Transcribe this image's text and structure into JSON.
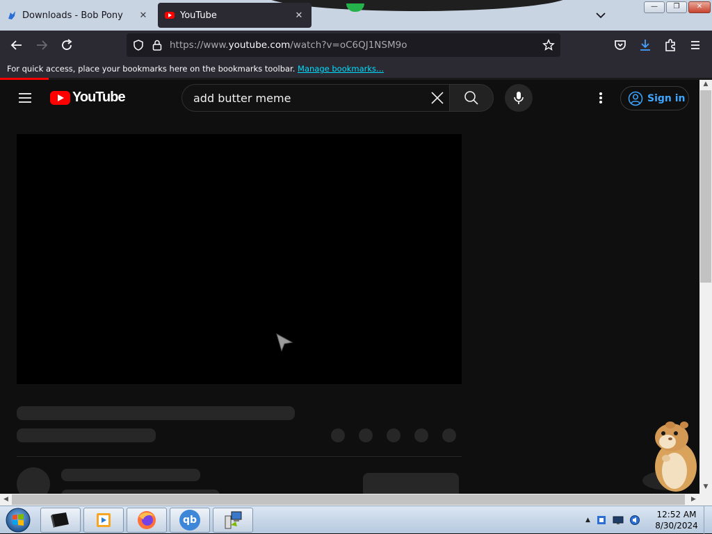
{
  "browser": {
    "tabs": [
      {
        "title": "Downloads - Bob Pony",
        "active": false
      },
      {
        "title": "YouTube",
        "active": true
      }
    ],
    "url": {
      "prefix": "https://www.",
      "domain": "youtube.com",
      "path": "/watch?v=oC6QJ1NSM9o"
    },
    "bookmarks_bar": {
      "message": "For quick access, place your bookmarks here on the bookmarks toolbar.",
      "link": "Manage bookmarks..."
    },
    "window_buttons": {
      "minimize": "—",
      "restore": "❐",
      "close": "✕"
    }
  },
  "youtube": {
    "logo_text": "YouTube",
    "search_query": "add butter meme",
    "sign_in_label": "Sign in",
    "colors": {
      "brand": "#ff0000",
      "accent": "#3ea6ff",
      "background": "#0f0f0f"
    }
  },
  "taskbar": {
    "time": "12:52 AM",
    "date": "8/30/2024",
    "pinned": [
      "terminal-icon",
      "media-player-icon",
      "firefox-icon",
      "qbittorrent-icon",
      "network-setup-icon"
    ],
    "qb_label": "qb"
  }
}
